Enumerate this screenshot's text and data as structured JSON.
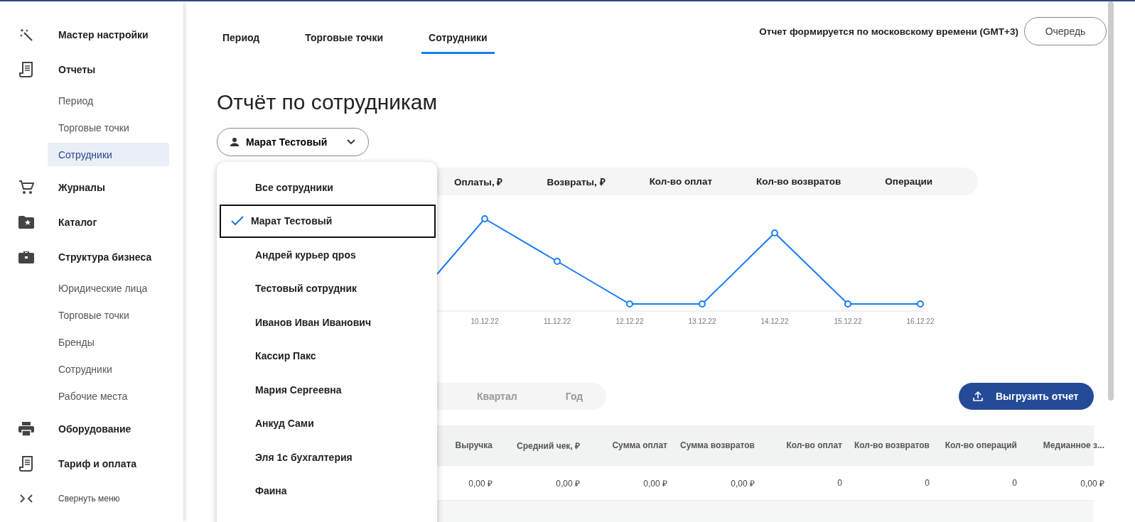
{
  "sidebar": {
    "items": [
      {
        "label": "Мастер настройки"
      },
      {
        "label": "Отчеты",
        "children": [
          {
            "label": "Период",
            "selected": false
          },
          {
            "label": "Торговые точки",
            "selected": false
          },
          {
            "label": "Сотрудники",
            "selected": true
          }
        ]
      },
      {
        "label": "Журналы"
      },
      {
        "label": "Каталог"
      },
      {
        "label": "Структура бизнеса",
        "children": [
          {
            "label": "Юридические лица",
            "selected": false
          },
          {
            "label": "Торговые точки",
            "selected": false
          },
          {
            "label": "Бренды",
            "selected": false
          },
          {
            "label": "Сотрудники",
            "selected": false
          },
          {
            "label": "Рабочие места",
            "selected": false
          }
        ]
      },
      {
        "label": "Оборудование"
      },
      {
        "label": "Тариф и оплата"
      }
    ],
    "collapse_label": "Свернуть меню"
  },
  "tabs": [
    {
      "label": "Период",
      "selected": false
    },
    {
      "label": "Торговые точки",
      "selected": false
    },
    {
      "label": "Сотрудники",
      "selected": true
    }
  ],
  "timezone_note": "Отчет формируется по московскому времени (GMT+3)",
  "queue_button": "Очередь",
  "title": "Отчёт по сотрудникам",
  "employee_select": {
    "value": "Марат Тестовый"
  },
  "dropdown": {
    "options": [
      {
        "label": "Все сотрудники",
        "selected": false
      },
      {
        "label": "Марат Тестовый",
        "selected": true
      },
      {
        "label": "Андрей курьер qpos",
        "selected": false
      },
      {
        "label": "Тестовый сотрудник",
        "selected": false
      },
      {
        "label": "Иванов Иван Иванович",
        "selected": false
      },
      {
        "label": "Кассир Пакс",
        "selected": false
      },
      {
        "label": "Мария Сергеевна",
        "selected": false
      },
      {
        "label": "Анкуд Сами",
        "selected": false
      },
      {
        "label": "Эля 1с бухгалтерия",
        "selected": false
      },
      {
        "label": "Фаина",
        "selected": false
      }
    ]
  },
  "metric_tabs": [
    "Оплаты, ₽",
    "Возвраты, ₽",
    "Кол-во оплат",
    "Кол-во возвратов",
    "Операции"
  ],
  "chart": {
    "x_labels": [
      "10.12.22",
      "11.12.22",
      "12.12.22",
      "13.12.22",
      "14.12.22",
      "15.12.22",
      "16.12.22"
    ]
  },
  "period_tabs": [
    "Квартал",
    "Год"
  ],
  "export_button": "Выгрузить отчет",
  "table": {
    "columns": [
      "Выручка",
      "Средний чек, ₽",
      "Сумма оплат",
      "Сумма возвратов",
      "Кол-во оплат",
      "Кол-во возвратов",
      "Кол-во операций",
      "Медианное з..."
    ],
    "rows": [
      [
        "0,00 ₽",
        "0,00 ₽",
        "0,00 ₽",
        "0,00 ₽",
        "0",
        "0",
        "0",
        "0,00 ₽"
      ]
    ]
  }
}
